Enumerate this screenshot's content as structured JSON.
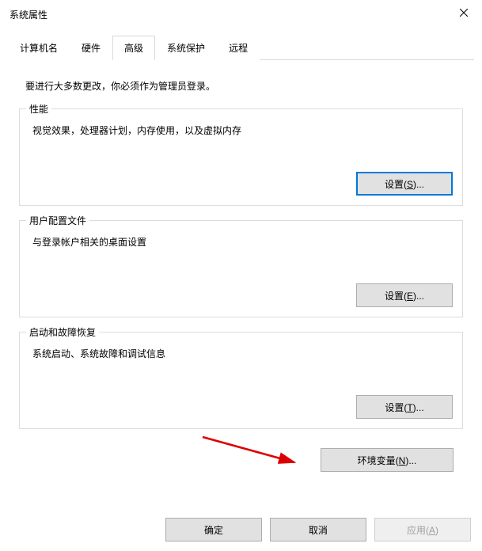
{
  "window": {
    "title": "系统属性"
  },
  "tabs": {
    "computer_name": "计算机名",
    "hardware": "硬件",
    "advanced": "高级",
    "system_protection": "系统保护",
    "remote": "远程"
  },
  "advanced": {
    "intro": "要进行大多数更改，你必须作为管理员登录。",
    "performance": {
      "title": "性能",
      "desc": "视觉效果，处理器计划，内存使用，以及虚拟内存",
      "button": "设置(S)..."
    },
    "profiles": {
      "title": "用户配置文件",
      "desc": "与登录帐户相关的桌面设置",
      "button": "设置(E)..."
    },
    "startup": {
      "title": "启动和故障恢复",
      "desc": "系统启动、系统故障和调试信息",
      "button": "设置(T)..."
    },
    "env_button": "环境变量(N)..."
  },
  "buttons": {
    "ok": "确定",
    "cancel": "取消",
    "apply": "应用(A)"
  }
}
